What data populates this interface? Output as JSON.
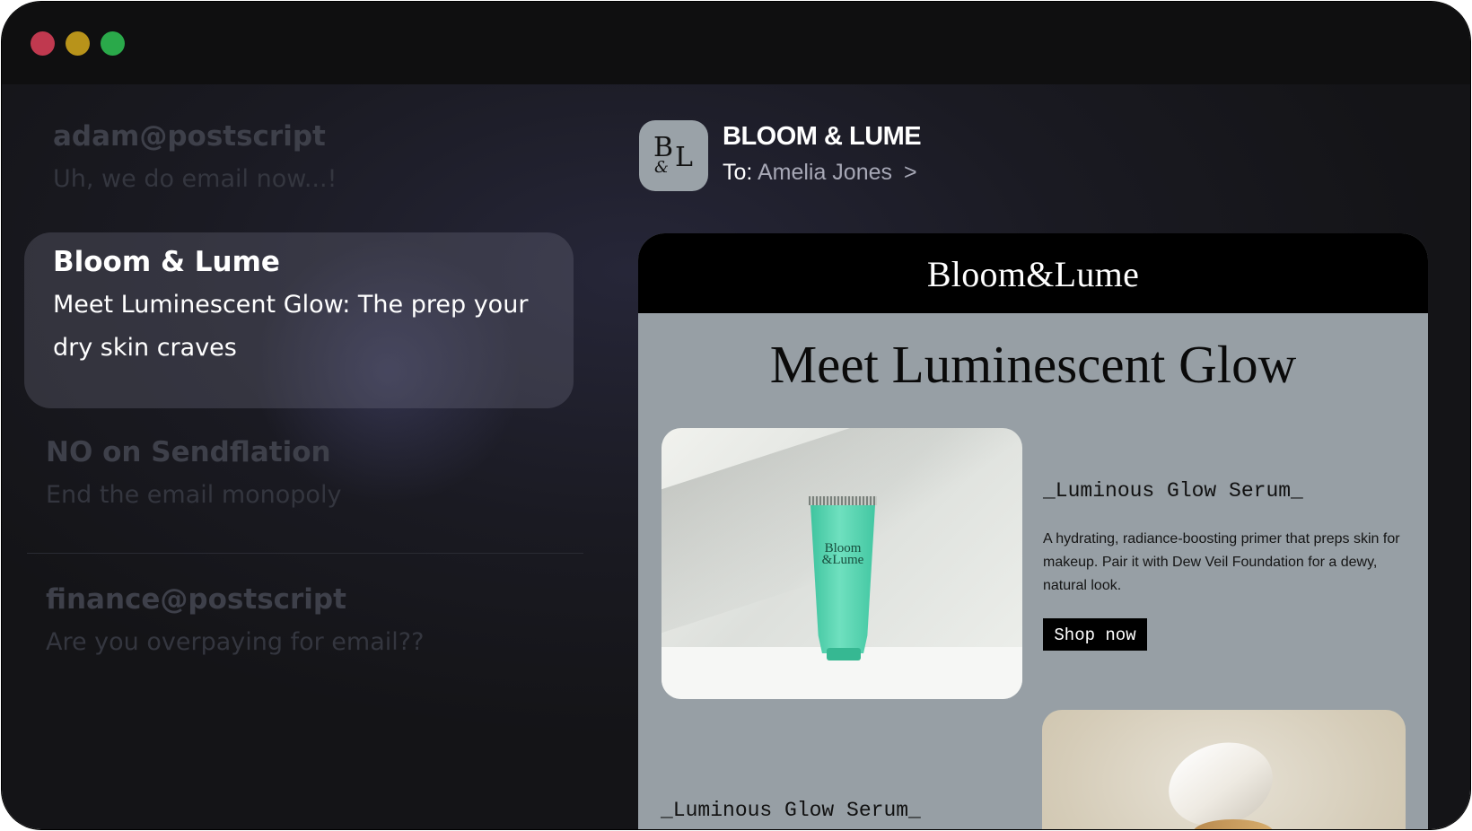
{
  "window": {
    "controls": [
      "close",
      "minimize",
      "zoom"
    ]
  },
  "mail_list": [
    {
      "sender": "adam@postscript",
      "subject": "Uh, we do email now...!",
      "state": "dimmed"
    },
    {
      "sender": "Bloom & Lume",
      "subject": "Meet Luminescent Glow: The prep your dry skin craves",
      "state": "selected"
    },
    {
      "sender": "NO on Sendflation",
      "subject": "End the email monopoly",
      "state": "dimmed"
    },
    {
      "sender": "finance@postscript",
      "subject": "Are you overpaying for email??",
      "state": "dimmed"
    }
  ],
  "message_header": {
    "avatar_letters": {
      "b": "B",
      "l": "L",
      "amp": "&"
    },
    "from": "BLOOM & LUME",
    "to_label": "To:",
    "to_name": "Amelia Jones",
    "to_chevron": ">"
  },
  "email": {
    "logo": "Bloom&Lume",
    "headline": "Meet Luminescent Glow",
    "products": [
      {
        "title": "_Luminous Glow Serum_",
        "description": "A hydrating, radiance-boosting primer that preps skin for makeup. Pair it with Dew Veil Foundation for a dewy, natural look.",
        "button": "Shop now",
        "packaging_text": "Bloom &Lume"
      },
      {
        "title": "_Luminous Glow Serum_"
      }
    ]
  },
  "colors": {
    "titlebar": "#0f0f10",
    "traffic_red": "#c0394f",
    "traffic_yellow": "#b8931a",
    "traffic_green": "#2aa94a",
    "email_background": "#979fa5",
    "email_banner": "#000000",
    "tube": "#4ccfa8",
    "shop_button": "#000000"
  },
  "icons": {
    "recipient_chevron": "chevron-right-icon"
  }
}
